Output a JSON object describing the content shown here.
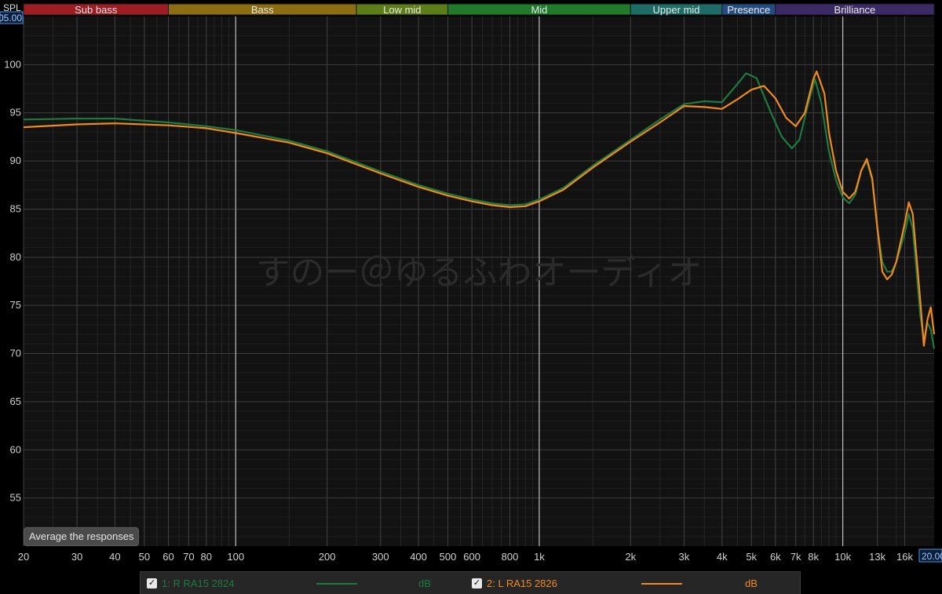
{
  "bands": [
    {
      "label": "Sub bass",
      "from": 20,
      "to": 60,
      "color": "#9e1c22"
    },
    {
      "label": "Bass",
      "from": 60,
      "to": 250,
      "color": "#8c6d12"
    },
    {
      "label": "Low mid",
      "from": 250,
      "to": 500,
      "color": "#5d7d17"
    },
    {
      "label": "Mid",
      "from": 500,
      "to": 2000,
      "color": "#1f7a2a"
    },
    {
      "label": "Upper mid",
      "from": 2000,
      "to": 4000,
      "color": "#1d6c66"
    },
    {
      "label": "Presence",
      "from": 4000,
      "to": 6000,
      "color": "#234d82"
    },
    {
      "label": "Brilliance",
      "from": 6000,
      "to": 20000,
      "color": "#3a2a66"
    }
  ],
  "axis": {
    "y_title": "SPL",
    "y_top_value": "105.00",
    "x_end_value": "20.00"
  },
  "watermark": "すのー＠ゆるふわオーディオ",
  "average_button": "Average the responses",
  "legend": [
    {
      "label": "1: R RA15 2824",
      "unit": "dB",
      "color": "#1d7a3e"
    },
    {
      "label": "2: L RA15 2826",
      "unit": "dB",
      "color": "#f08a1c"
    }
  ],
  "chart_data": {
    "type": "line",
    "xscale": "log",
    "xlim": [
      20,
      20000
    ],
    "ylim": [
      50,
      105
    ],
    "grid": true,
    "xlabel": "",
    "ylabel": "SPL",
    "x_ticks": [
      {
        "value": 20,
        "label": "20"
      },
      {
        "value": 30,
        "label": "30"
      },
      {
        "value": 40,
        "label": "40"
      },
      {
        "value": 50,
        "label": "50"
      },
      {
        "value": 60,
        "label": "60"
      },
      {
        "value": 70,
        "label": "70"
      },
      {
        "value": 80,
        "label": "80"
      },
      {
        "value": 100,
        "label": "100"
      },
      {
        "value": 200,
        "label": "200"
      },
      {
        "value": 300,
        "label": "300"
      },
      {
        "value": 400,
        "label": "400"
      },
      {
        "value": 500,
        "label": "500"
      },
      {
        "value": 600,
        "label": "600"
      },
      {
        "value": 800,
        "label": "800"
      },
      {
        "value": 1000,
        "label": "1k"
      },
      {
        "value": 2000,
        "label": "2k"
      },
      {
        "value": 3000,
        "label": "3k"
      },
      {
        "value": 4000,
        "label": "4k"
      },
      {
        "value": 5000,
        "label": "5k"
      },
      {
        "value": 6000,
        "label": "6k"
      },
      {
        "value": 7000,
        "label": "7k"
      },
      {
        "value": 8000,
        "label": "8k"
      },
      {
        "value": 10000,
        "label": "10k"
      },
      {
        "value": 13000,
        "label": "13k"
      },
      {
        "value": 16000,
        "label": "16k"
      }
    ],
    "y_ticks": [
      55,
      60,
      65,
      70,
      75,
      80,
      85,
      90,
      95,
      100
    ],
    "series": [
      {
        "name": "1: R RA15 2824",
        "color": "#1d7a3e",
        "points": [
          [
            20,
            94.3
          ],
          [
            30,
            94.4
          ],
          [
            40,
            94.4
          ],
          [
            60,
            94.0
          ],
          [
            80,
            93.6
          ],
          [
            100,
            93.2
          ],
          [
            150,
            92.1
          ],
          [
            200,
            91.0
          ],
          [
            300,
            88.9
          ],
          [
            400,
            87.5
          ],
          [
            500,
            86.6
          ],
          [
            600,
            86.0
          ],
          [
            700,
            85.6
          ],
          [
            800,
            85.4
          ],
          [
            900,
            85.5
          ],
          [
            1000,
            86.0
          ],
          [
            1200,
            87.2
          ],
          [
            1500,
            89.5
          ],
          [
            2000,
            92.2
          ],
          [
            2500,
            94.3
          ],
          [
            3000,
            95.9
          ],
          [
            3500,
            96.2
          ],
          [
            4000,
            96.1
          ],
          [
            4500,
            98.0
          ],
          [
            4800,
            99.1
          ],
          [
            5200,
            98.6
          ],
          [
            5800,
            95.0
          ],
          [
            6300,
            92.5
          ],
          [
            6800,
            91.3
          ],
          [
            7200,
            92.2
          ],
          [
            7700,
            96.0
          ],
          [
            8100,
            98.5
          ],
          [
            8500,
            96.0
          ],
          [
            9000,
            91.0
          ],
          [
            9500,
            88.0
          ],
          [
            10000,
            86.2
          ],
          [
            10500,
            85.6
          ],
          [
            11000,
            86.5
          ],
          [
            11500,
            89.0
          ],
          [
            12000,
            90.0
          ],
          [
            12500,
            88.0
          ],
          [
            13000,
            83.0
          ],
          [
            13500,
            79.5
          ],
          [
            14000,
            78.5
          ],
          [
            14500,
            78.5
          ],
          [
            15000,
            79.5
          ],
          [
            16000,
            82.5
          ],
          [
            16500,
            84.5
          ],
          [
            17000,
            83.0
          ],
          [
            17500,
            78.5
          ],
          [
            18000,
            74.0
          ],
          [
            18500,
            71.5
          ],
          [
            19000,
            73.2
          ],
          [
            19500,
            72.5
          ],
          [
            20000,
            70.5
          ]
        ]
      },
      {
        "name": "2: L RA15 2826",
        "color": "#f08a1c",
        "points": [
          [
            20,
            93.5
          ],
          [
            30,
            93.8
          ],
          [
            40,
            93.9
          ],
          [
            60,
            93.7
          ],
          [
            80,
            93.4
          ],
          [
            100,
            92.9
          ],
          [
            150,
            91.9
          ],
          [
            200,
            90.8
          ],
          [
            300,
            88.7
          ],
          [
            400,
            87.3
          ],
          [
            500,
            86.4
          ],
          [
            600,
            85.8
          ],
          [
            700,
            85.4
          ],
          [
            800,
            85.2
          ],
          [
            900,
            85.3
          ],
          [
            1000,
            85.8
          ],
          [
            1200,
            87.0
          ],
          [
            1500,
            89.3
          ],
          [
            2000,
            92.0
          ],
          [
            2500,
            94.0
          ],
          [
            3000,
            95.7
          ],
          [
            3500,
            95.6
          ],
          [
            4000,
            95.4
          ],
          [
            4500,
            96.4
          ],
          [
            5000,
            97.4
          ],
          [
            5500,
            97.8
          ],
          [
            6000,
            96.5
          ],
          [
            6500,
            94.5
          ],
          [
            7000,
            93.6
          ],
          [
            7500,
            95.0
          ],
          [
            8000,
            98.5
          ],
          [
            8200,
            99.3
          ],
          [
            8700,
            97.0
          ],
          [
            9000,
            93.0
          ],
          [
            9500,
            89.0
          ],
          [
            10000,
            86.8
          ],
          [
            10500,
            86.1
          ],
          [
            11000,
            86.8
          ],
          [
            11500,
            89.0
          ],
          [
            12000,
            90.2
          ],
          [
            12500,
            88.2
          ],
          [
            13000,
            83.0
          ],
          [
            13500,
            78.5
          ],
          [
            14000,
            77.7
          ],
          [
            14500,
            78.2
          ],
          [
            15000,
            79.5
          ],
          [
            16000,
            83.5
          ],
          [
            16500,
            85.7
          ],
          [
            17000,
            84.5
          ],
          [
            17500,
            80.0
          ],
          [
            18000,
            75.5
          ],
          [
            18500,
            70.8
          ],
          [
            19000,
            73.5
          ],
          [
            19500,
            74.8
          ],
          [
            20000,
            72.0
          ]
        ]
      }
    ]
  }
}
